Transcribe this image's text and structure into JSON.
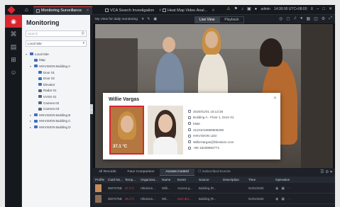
{
  "topbar": {
    "tabs": [
      {
        "label": "Monitoring Surveillance",
        "active": true
      },
      {
        "label": "VCA Search Investigation",
        "active": false
      },
      {
        "label": "Heat Map Video Anal...",
        "active": false
      }
    ],
    "admin_label": "admin",
    "datetime": "14:30:00 UTC+08:00"
  },
  "sidebar": {
    "title": "Monitoring",
    "search_placeholder": "Search",
    "site_select": "Local Site",
    "tree": [
      {
        "label": "Local Site",
        "level": 0,
        "arrow": "▾",
        "icon": "site"
      },
      {
        "label": "Map",
        "level": 1,
        "arrow": "",
        "icon": "map"
      },
      {
        "label": "HIKVISION Building A",
        "level": 1,
        "arrow": "▾",
        "icon": "building"
      },
      {
        "label": "Door 01",
        "level": 2,
        "arrow": "",
        "icon": "door"
      },
      {
        "label": "Door 02",
        "level": 2,
        "arrow": "",
        "icon": "door"
      },
      {
        "label": "Elevator",
        "level": 2,
        "arrow": "",
        "icon": "door"
      },
      {
        "label": "Radar 01",
        "level": 2,
        "arrow": "",
        "icon": "radar"
      },
      {
        "label": "UVSS 01",
        "level": 2,
        "arrow": "",
        "icon": "uvss"
      },
      {
        "label": "Camera 02",
        "level": 2,
        "arrow": "",
        "icon": "camera"
      },
      {
        "label": "Camera 03",
        "level": 2,
        "arrow": "",
        "icon": "camera"
      },
      {
        "label": "HIKVISION Building B",
        "level": 1,
        "arrow": "▸",
        "icon": "building"
      },
      {
        "label": "HIKVISION Building C",
        "level": 1,
        "arrow": "▸",
        "icon": "building"
      },
      {
        "label": "HIKVISION Building D",
        "level": 1,
        "arrow": "▸",
        "icon": "building"
      }
    ]
  },
  "main": {
    "view_label": "My View for daily monitoring",
    "view_tabs": [
      "Live View",
      "Playback"
    ],
    "active_view_tab": "Live View"
  },
  "popup": {
    "name": "Willie Vargas",
    "temperature": "37.1 °C",
    "info": [
      {
        "icon": "calendar-icon",
        "text": "2020/01/01 16:13:36"
      },
      {
        "icon": "location-icon",
        "text": "Building A - Floor 1, Door 01"
      },
      {
        "icon": "person-icon",
        "text": "Male"
      },
      {
        "icon": "id-card-icon",
        "text": "21101019889908268"
      },
      {
        "icon": "company-icon",
        "text": "HIKVISION LED"
      },
      {
        "icon": "email-icon",
        "text": "WillieVargas@hikvision.com"
      },
      {
        "icon": "phone-icon",
        "text": "+86 18169892771"
      }
    ]
  },
  "bottom": {
    "tabs": [
      "All Records",
      "Face Comparison",
      "Access Control"
    ],
    "active_tab": "Access Control",
    "subscribed_label": "Subscribed Events",
    "columns": [
      "Profile",
      "Card No...",
      "Temp...",
      "Organizat...",
      "Name",
      "Event",
      "Source",
      "Description",
      "Time",
      "Operation"
    ],
    "rows": [
      {
        "card": "0827075B",
        "temp": "37.1°C",
        "temp_alert": true,
        "org": "Hikvision...",
        "name": "Willi...",
        "event": "Access g...",
        "source": "Building (R...",
        "desc": "",
        "time": "01/01/2020"
      },
      {
        "card": "0827075B",
        "temp": "36.1°C",
        "temp_alert": true,
        "org": "Hikvision...",
        "name": "Wil...",
        "event": "over-dur...",
        "source": "Building (R...",
        "desc": "",
        "time": "01/01/2020"
      }
    ]
  },
  "colors": {
    "accent": "#d9262e",
    "background": "#1d2127",
    "sidebar": "#f4f5f7",
    "alert_text": "#e04040"
  }
}
